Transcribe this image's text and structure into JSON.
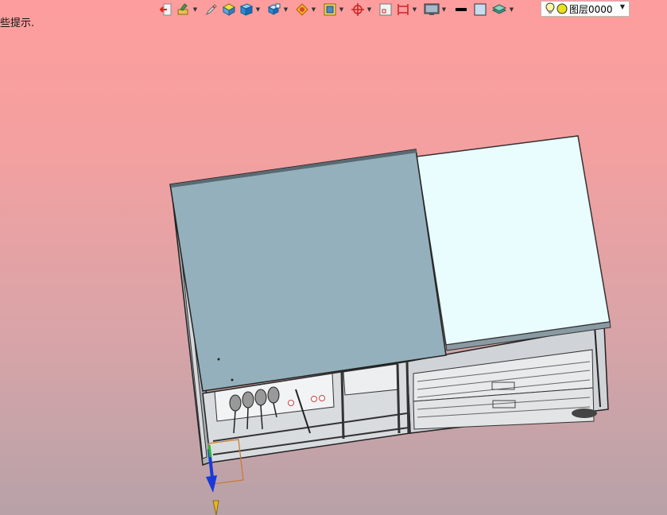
{
  "status": {
    "hint_text": "些提示."
  },
  "toolbar": {
    "layer": {
      "name": "图层0000"
    },
    "colors": {
      "line_color": "#000000",
      "fill_color": "#c8dcf0"
    }
  },
  "viewport": {
    "background_top": "#fe9d9d",
    "background_bottom": "#b7a2a8",
    "panel_left_color": "#94b0bc",
    "panel_right_color": "#e9fcfe"
  }
}
